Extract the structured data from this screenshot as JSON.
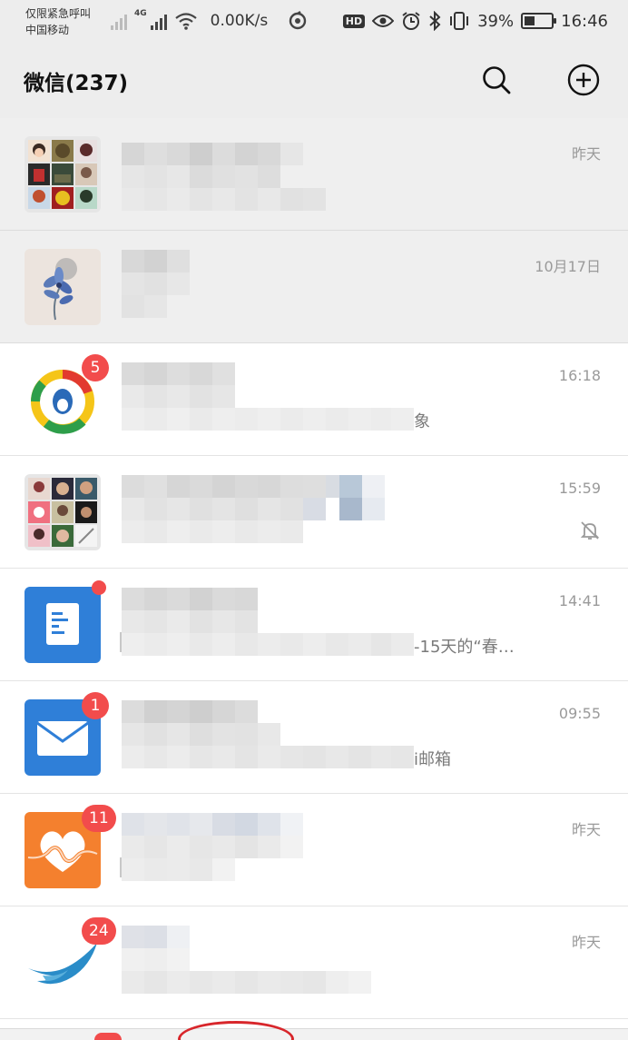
{
  "status_bar": {
    "carrier_line1": "仅限紧急呼叫",
    "carrier_line2": "中国移动",
    "net_type": "4G",
    "speed": "0.00K/s",
    "hd": "HD",
    "battery_percent": "39%",
    "battery_level": 0.39,
    "time": "16:46",
    "icons": [
      "signal-icon",
      "wifi-icon",
      "netease-icon",
      "eye-icon",
      "alarm-icon",
      "bluetooth-icon",
      "vibrate-icon",
      "battery-icon"
    ]
  },
  "header": {
    "title": "微信(237)",
    "search_icon": "search-icon",
    "add_icon": "plus-circle-icon"
  },
  "chats": [
    {
      "time": "昨天",
      "pinned": true,
      "avatar": "group-grid-avatar"
    },
    {
      "time": "10月17日",
      "pinned": true,
      "avatar": "flower-avatar"
    },
    {
      "time": "16:18",
      "badge": "5",
      "preview_suffix": "象",
      "avatar": "tencent-news-avatar"
    },
    {
      "time": "15:59",
      "muted": true,
      "avatar": "group-grid-avatar-2"
    },
    {
      "time": "14:41",
      "dot": true,
      "preview_suffix": "-15天的“春…",
      "avatar": "document-avatar"
    },
    {
      "time": "09:55",
      "badge": "1",
      "preview_suffix": "i邮箱",
      "avatar": "mail-avatar"
    },
    {
      "time": "昨天",
      "badge": "11",
      "avatar": "health-avatar"
    },
    {
      "time": "昨天",
      "badge": "24",
      "avatar": "wave-avatar"
    }
  ],
  "colors": {
    "badge": "#f24c4c",
    "header_bg": "#ededed",
    "pinned_bg": "#efefef",
    "annotation_circle": "#d8262b"
  }
}
